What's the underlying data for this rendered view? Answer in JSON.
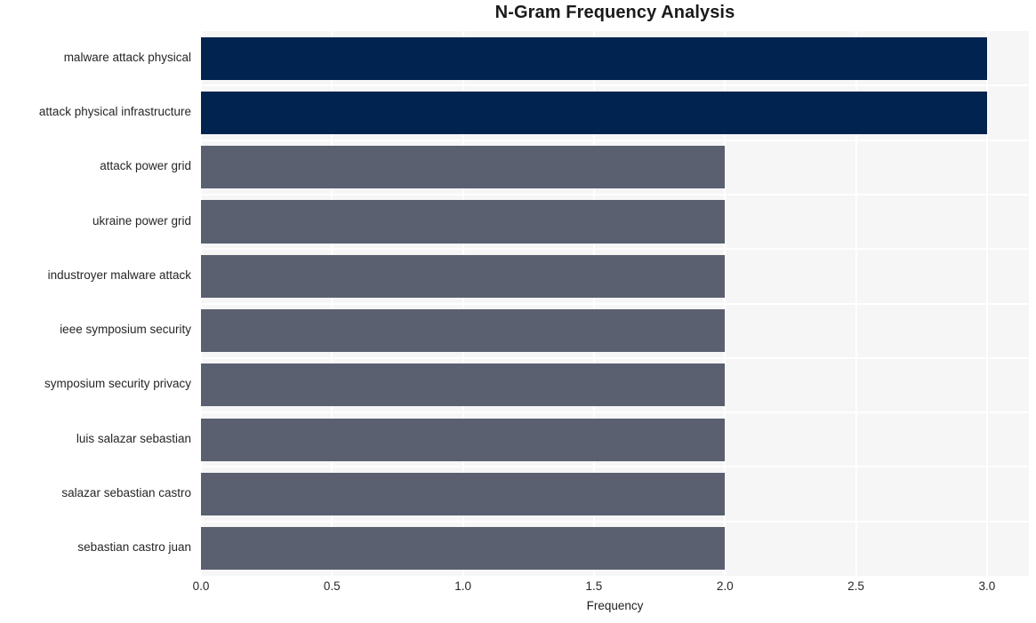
{
  "chart_data": {
    "type": "bar",
    "orientation": "horizontal",
    "title": "N-Gram Frequency Analysis",
    "xlabel": "Frequency",
    "ylabel": "",
    "categories": [
      "malware attack physical",
      "attack physical infrastructure",
      "attack power grid",
      "ukraine power grid",
      "industroyer malware attack",
      "ieee symposium security",
      "symposium security privacy",
      "luis salazar sebastian",
      "salazar sebastian castro",
      "sebastian castro juan"
    ],
    "values": [
      3.0,
      3.0,
      2.0,
      2.0,
      2.0,
      2.0,
      2.0,
      2.0,
      2.0,
      2.0
    ],
    "bar_colors": [
      "#002350",
      "#002350",
      "#5a6070",
      "#5a6070",
      "#5a6070",
      "#5a6070",
      "#5a6070",
      "#5a6070",
      "#5a6070",
      "#5a6070"
    ],
    "xlim": [
      0.0,
      3.16
    ],
    "xticks": [
      0.0,
      0.5,
      1.0,
      1.5,
      2.0,
      2.5,
      3.0
    ],
    "xtick_labels": [
      "0.0",
      "0.5",
      "1.0",
      "1.5",
      "2.0",
      "2.5",
      "3.0"
    ],
    "grid": true,
    "grid_color": "#ffffff",
    "plot_background": "#f6f6f7",
    "figure_background": "#ffffff",
    "legend": null,
    "title_color": "#1a1a1a",
    "tick_label_color": "#262626"
  }
}
